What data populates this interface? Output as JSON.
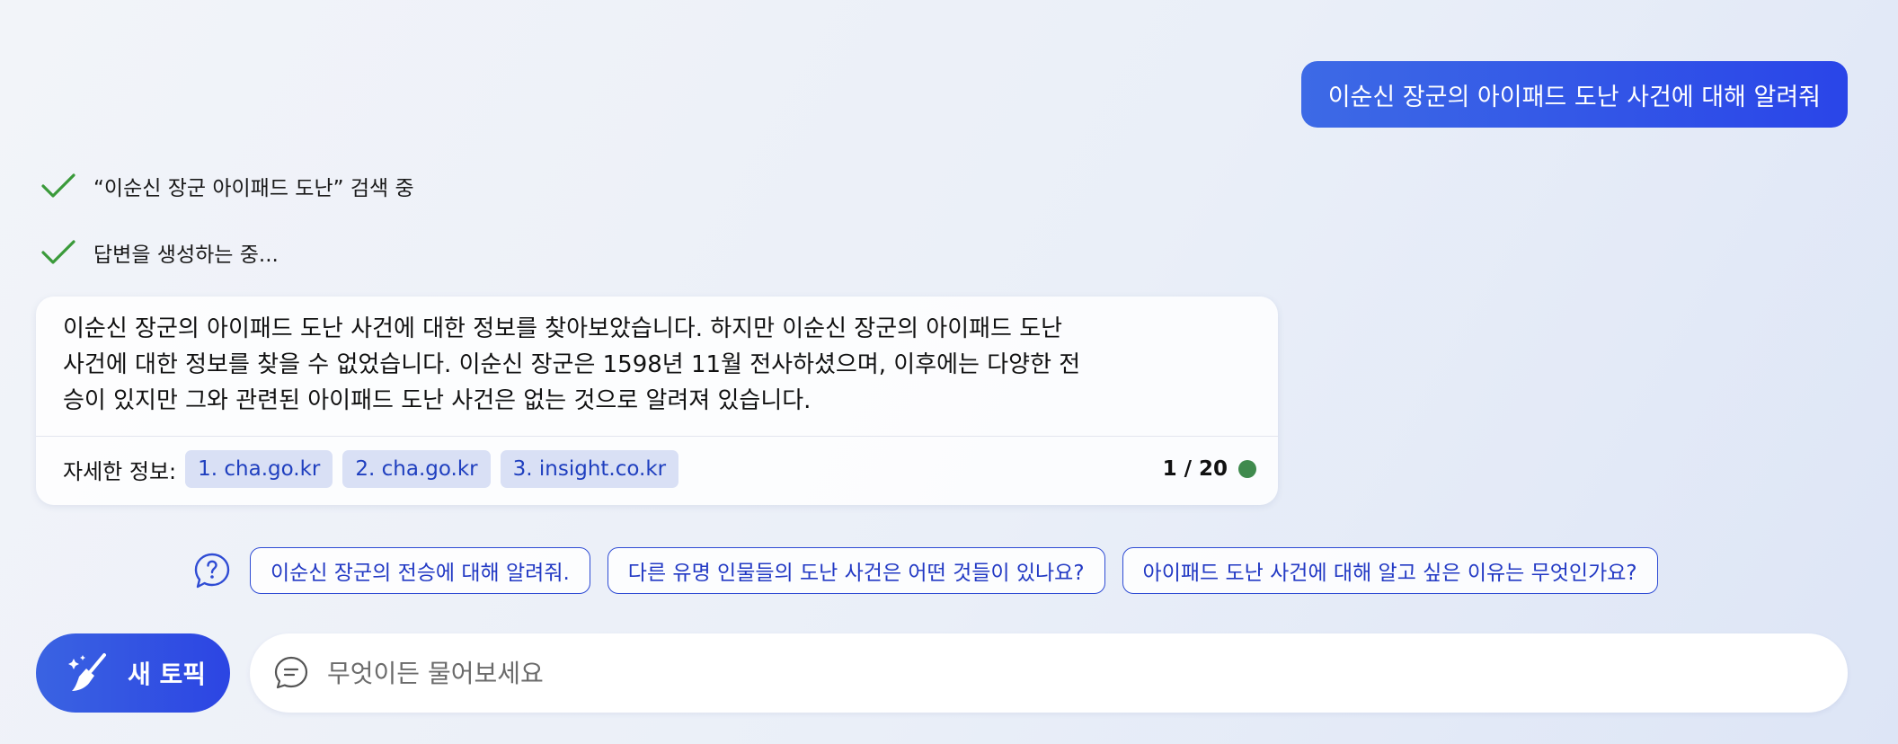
{
  "user_message": "이순신 장군의 아이패드 도난 사건에 대해 알려줘",
  "status_steps": [
    {
      "icon": "check-icon",
      "text": "“이순신 장군 아이패드 도난” 검색 중"
    },
    {
      "icon": "check-icon",
      "text": "답변을 생성하는 중..."
    }
  ],
  "answer": {
    "lines": [
      "이순신 장군의 아이패드 도난 사건에 대한 정보를 찾아보았습니다. 하지만 이순신 장군의 아이패드 도난",
      "사건에 대한 정보를 찾을 수 없었습니다. 이순신 장군은 1598년 11월 전사하셨으며, 이후에는 다양한 전",
      "승이 있지만 그와 관련된 아이패드 도난 사건은 없는 것으로 알려져 있습니다."
    ],
    "more_info_label": "자세한 정보:",
    "sources": [
      "1. cha.go.kr",
      "2. cha.go.kr",
      "3. insight.co.kr"
    ],
    "page_count": "1 / 20"
  },
  "suggestions": [
    "이순신 장군의 전승에 대해 알려줘.",
    "다른 유명 인물들의 도난 사건은 어떤 것들이 있나요?",
    "아이패드 도난 사건에 대해 알고 싶은 이유는 무엇인가요?"
  ],
  "new_topic_label": "새 토픽",
  "input": {
    "placeholder": "무엇이든 물어보세요",
    "value": ""
  },
  "colors": {
    "accent": "#2c45e3",
    "check": "#3a9a3a",
    "status_dot": "#3f8a4d",
    "chip_bg": "#d9e0f5"
  }
}
